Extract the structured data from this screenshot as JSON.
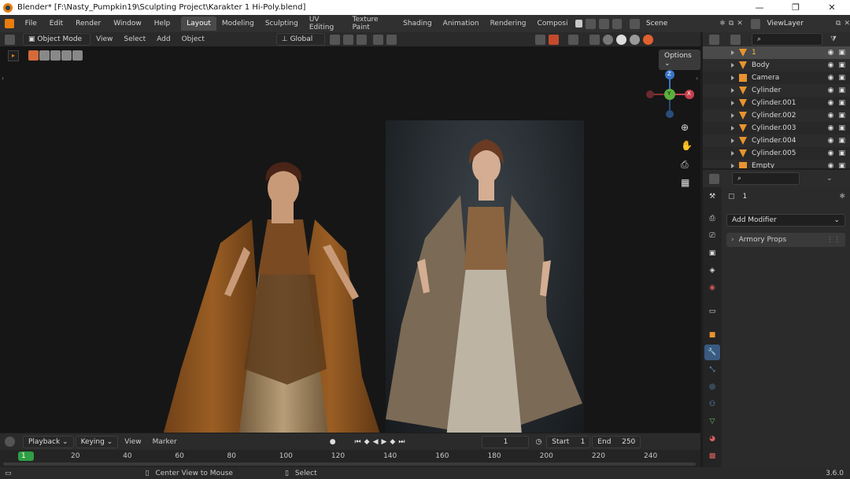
{
  "titlebar": {
    "title": "Blender* [F:\\Nasty_Pumpkin19\\Sculpting Project\\Karakter 1 Hi-Poly.blend]",
    "minimize": "—",
    "maximize": "❐",
    "close": "✕"
  },
  "menu": [
    "File",
    "Edit",
    "Render",
    "Window",
    "Help"
  ],
  "workspaces": [
    "Layout",
    "Modeling",
    "Sculpting",
    "UV Editing",
    "Texture Paint",
    "Shading",
    "Animation",
    "Rendering",
    "Composi"
  ],
  "scene_label": "Scene",
  "viewlayer_label": "ViewLayer",
  "viewport_header": {
    "mode": "Object Mode",
    "view": "View",
    "select": "Select",
    "add": "Add",
    "object": "Object",
    "transform": "Global",
    "options": "Options"
  },
  "gizmo": {
    "z": "Z",
    "y": "Y",
    "x": "X"
  },
  "outliner": {
    "items": [
      {
        "name": "1",
        "icon": "mesh-icon",
        "selected": true
      },
      {
        "name": "Body",
        "icon": "mesh-icon"
      },
      {
        "name": "Camera",
        "icon": "camera-icon"
      },
      {
        "name": "Cylinder",
        "icon": "mesh-icon"
      },
      {
        "name": "Cylinder.001",
        "icon": "mesh-icon"
      },
      {
        "name": "Cylinder.002",
        "icon": "mesh-icon"
      },
      {
        "name": "Cylinder.003",
        "icon": "mesh-icon"
      },
      {
        "name": "Cylinder.004",
        "icon": "mesh-icon"
      },
      {
        "name": "Cylinder.005",
        "icon": "mesh-icon"
      },
      {
        "name": "Empty",
        "icon": "empty-icon"
      }
    ]
  },
  "properties": {
    "object_name": "1",
    "add_modifier": "Add Modifier",
    "panel": "Armory Props"
  },
  "timeline": {
    "playback": "Playback",
    "keying": "Keying",
    "view": "View",
    "marker": "Marker",
    "current_frame": "1",
    "start_label": "Start",
    "start": "1",
    "end_label": "End",
    "end": "250",
    "ticks": [
      "1",
      "20",
      "40",
      "60",
      "80",
      "100",
      "120",
      "140",
      "160",
      "180",
      "200",
      "220",
      "240"
    ]
  },
  "status": {
    "center_view": "Center View to Mouse",
    "select": "Select",
    "version": "3.6.0"
  },
  "colors": {
    "accent": "#e87d0d",
    "selection": "#4a4a4a",
    "frame_marker": "#2f9e44"
  }
}
